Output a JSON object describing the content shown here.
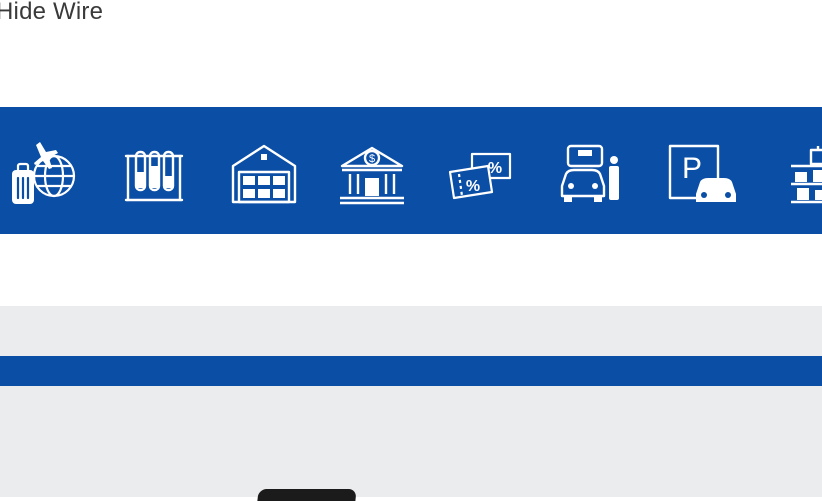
{
  "top_link": {
    "label": "Hide Wire"
  },
  "icon_row": {
    "background_color": "#0a4ea6",
    "icons": [
      {
        "name": "airport-travel-icon"
      },
      {
        "name": "laboratory-tubes-icon"
      },
      {
        "name": "warehouse-icon"
      },
      {
        "name": "bank-icon"
      },
      {
        "name": "discount-coupon-icon"
      },
      {
        "name": "car-valet-icon"
      },
      {
        "name": "parking-icon"
      },
      {
        "name": "retail-shelves-icon"
      }
    ],
    "parking_sign_letter": "P"
  },
  "section_strip": {
    "color": "#0a4ea6"
  },
  "page_background": "#ebecee"
}
